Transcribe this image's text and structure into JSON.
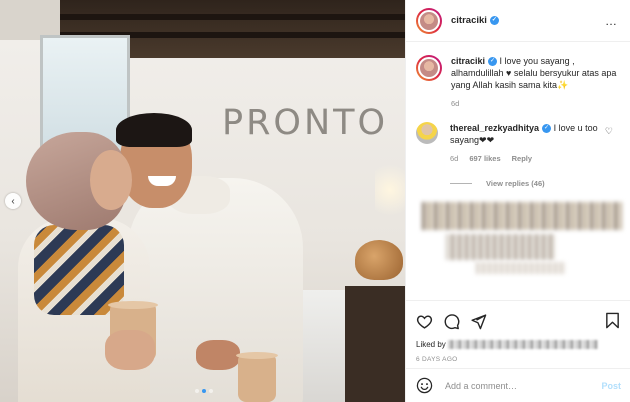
{
  "post": {
    "username": "citraciki",
    "more_icon": "…",
    "caption_text": "I love you sayang , alhamdulillah ♥ selalu bersyukur atas apa yang Allah kasih sama kita✨",
    "caption_age": "6d",
    "photo_sign": "PRONTO",
    "carousel_prev_icon": "‹"
  },
  "comments": [
    {
      "username": "thereal_rezkyadhitya",
      "text": "I love u too sayang❤❤",
      "age": "6d",
      "likes": "697 likes",
      "reply_label": "Reply",
      "view_replies": "View replies (46)"
    }
  ],
  "actions": {
    "liked_by_prefix": "Liked by",
    "date": "6 days ago"
  },
  "add_comment": {
    "placeholder": "Add a comment…",
    "post_label": "Post"
  },
  "colors": {
    "accent": "#3897f0",
    "post_disabled": "#b2dffc",
    "heart": "#c71a1a"
  }
}
